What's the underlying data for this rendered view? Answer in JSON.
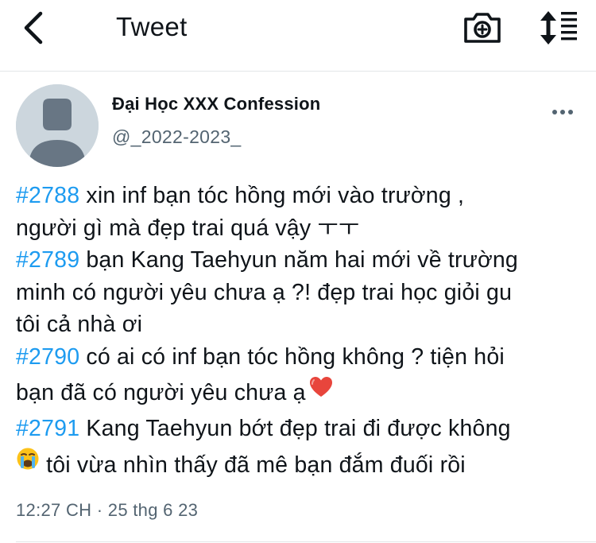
{
  "header": {
    "title": "Tweet",
    "back_icon": "chevron-left-icon",
    "camera_icon": "camera-plus-icon",
    "sort_icon": "sort-toggle-icon"
  },
  "tweet": {
    "author": {
      "display_name": "Đại Học XXX Confession",
      "handle": "@_2022-2023_"
    },
    "lines": [
      {
        "tag": "#2788",
        "text": " xin inf bạn tóc hồng mới vào trường ,"
      },
      {
        "tag": "",
        "text": "người gì mà đẹp trai quá vậy ㅜㅜ"
      },
      {
        "tag": "#2789",
        "text": " bạn Kang Taehyun năm hai mới về trường"
      },
      {
        "tag": "",
        "text": "minh có người yêu chưa ạ ?! đẹp trai học giỏi gu"
      },
      {
        "tag": "",
        "text": "tôi cả nhà ơi"
      },
      {
        "tag": "#2790",
        "text": " có ai có inf bạn tóc hồng không ? tiện hỏi"
      },
      {
        "tag": "",
        "text": "bạn đã có người yêu chưa ạ"
      },
      {
        "tag": "#2791",
        "text": " Kang Taehyun bớt đẹp trai đi được không"
      },
      {
        "tag": "",
        "text": " tôi vừa nhìn thấy đã mê bạn đắm đuối rồi"
      }
    ],
    "emojis": [
      "red-heart-emoji",
      "loudly-crying-face-emoji"
    ],
    "timestamp": "12:27 CH · 25 thg 6 23"
  },
  "colors": {
    "hashtag": "#1d9bf0",
    "secondary_text": "#536471",
    "avatar_bg": "#ccd6dd",
    "avatar_figure": "#687684",
    "divider": "#e3e6e8"
  }
}
